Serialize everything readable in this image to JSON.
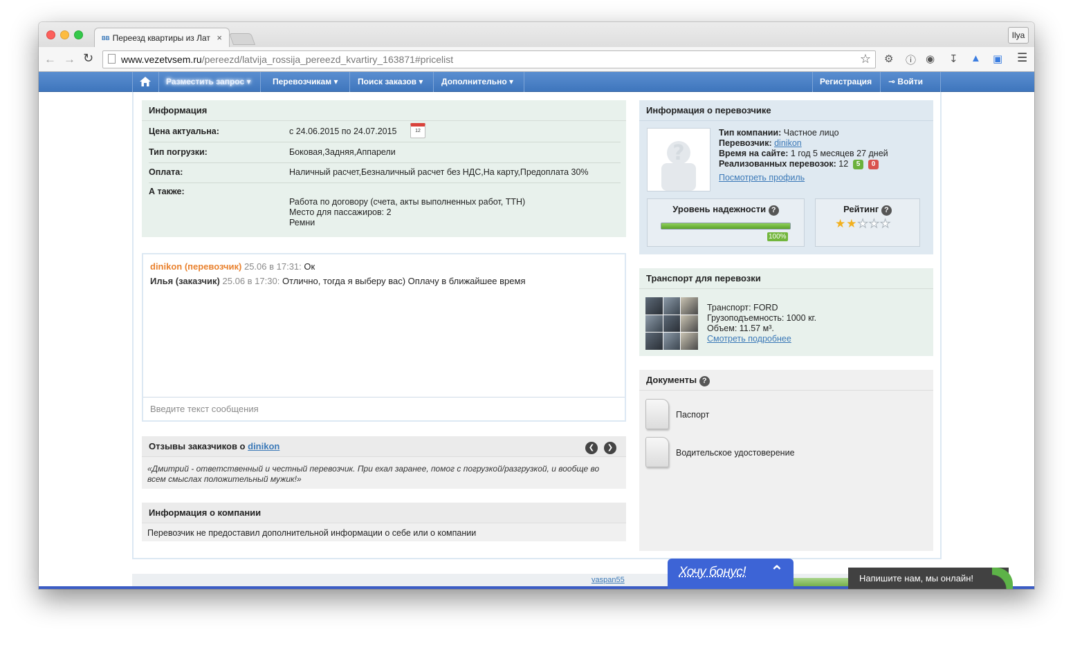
{
  "browser": {
    "tab_title": "Переезд квартиры из Лат",
    "tab_favicon": "ВВ",
    "tab_close": "×",
    "profile": "Ilya",
    "url_domain": "www.vezetvsem.ru",
    "url_path": "/pereezd/latvija_rossija_pereezd_kvartiry_163871#pricelist"
  },
  "nav": {
    "post_request": "Разместить запрос",
    "carriers": "Перевозчикам",
    "search_orders": "Поиск заказов",
    "more": "Дополнительно",
    "register": "Регистрация",
    "login": "Войти"
  },
  "info": {
    "title": "Информация",
    "rows": [
      {
        "label": "Цена актуальна:",
        "value": "с 24.06.2015 по 24.07.2015"
      },
      {
        "label": "Тип погрузки:",
        "value": "Боковая,Задняя,Аппарели"
      },
      {
        "label": "Оплата:",
        "value": "Наличный расчет,Безналичный расчет без НДС,На карту,Предоплата 30%"
      },
      {
        "label": "А также:",
        "value": ""
      }
    ],
    "extras": [
      "Работа по договору (счета, акты выполненных работ, ТТН)",
      "Место для пассажиров: 2",
      "Ремни"
    ],
    "calendar_day": "12"
  },
  "chat": {
    "messages": [
      {
        "author": "dinikon (перевозчик)",
        "time": "25.06 в 17:31:",
        "text": "Ок"
      },
      {
        "author": "Илья (заказчик)",
        "time": "25.06 в 17:30:",
        "text": "Отлично, тогда я выберу вас) Оплачу в ближайшее время"
      }
    ],
    "placeholder": "Введите текст сообщения"
  },
  "reviews": {
    "title_prefix": "Отзывы заказчиков о",
    "carrier": "dinikon",
    "quote": "«Дмитрий - ответственный и честный перевозчик. При ехал заранее, помог с погрузкой/разгрузкой, и вообще во всем смыслах положительный мужик!»"
  },
  "company": {
    "title": "Информация о компании",
    "text": "Перевозчик не предоставил дополнительной информации о себе или о компании"
  },
  "carrier": {
    "title": "Информация о перевозчике",
    "type_label": "Тип компании:",
    "type_value": "Частное лицо",
    "carrier_label": "Перевозчик:",
    "carrier_value": "dinikon",
    "time_label": "Время на сайте:",
    "time_value": "1 год 5 месяцев 27 дней",
    "done_label": "Реализованных перевозок:",
    "done_value": "12",
    "positive": "5",
    "negative": "0",
    "profile_link": "Посмотреть профиль",
    "reliability_title": "Уровень надежности",
    "reliability_pct": "100%",
    "reliability_value": 100,
    "rating_title": "Рейтинг",
    "rating_value": 2,
    "rating_max": 5,
    "help": "?"
  },
  "transport": {
    "title": "Транспорт для перевозки",
    "vehicle": "Транспорт: FORD",
    "capacity": "Грузоподъемность: 1000 кг.",
    "volume": "Объем: 11.57 м³.",
    "more_link": "Смотреть подробнее"
  },
  "documents": {
    "title": "Документы",
    "items": [
      "Паспорт",
      "Водительское удостоверение"
    ]
  },
  "footer": {
    "user_link": "vaspan55",
    "bonus": "Хочу бонус!",
    "chat_online": "Напишите нам, мы онлайн!"
  },
  "colors": {
    "nav_blue": "#4a82c6",
    "carrier_orange": "#e9822f",
    "link_blue": "#3a78b7",
    "bonus_blue": "#3d64d6"
  }
}
